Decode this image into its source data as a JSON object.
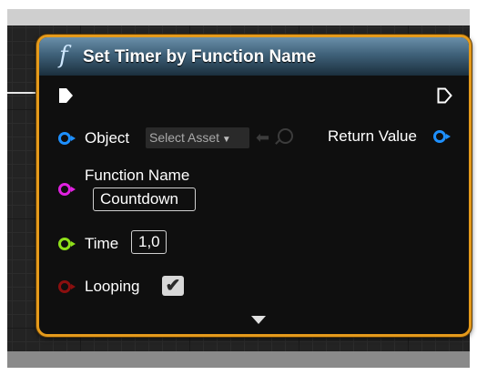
{
  "node": {
    "title": "Set Timer by Function Name",
    "icon": "function-icon",
    "function_symbol": "f",
    "header_color": "#3f6179",
    "border_color": "#e59a1b"
  },
  "pins": {
    "object_label": "Object",
    "object_select_value": "Select Asset",
    "return_value_label": "Return Value",
    "function_name_label": "Function Name",
    "function_name_value": "Countdown",
    "time_label": "Time",
    "time_value": "1,0",
    "looping_label": "Looping",
    "looping_checked": true,
    "colors": {
      "object": "#1e90ff",
      "function_name": "#e021e0",
      "time": "#8fe01a",
      "looping": "#8b0f0f",
      "return_value": "#1e90ff"
    }
  }
}
